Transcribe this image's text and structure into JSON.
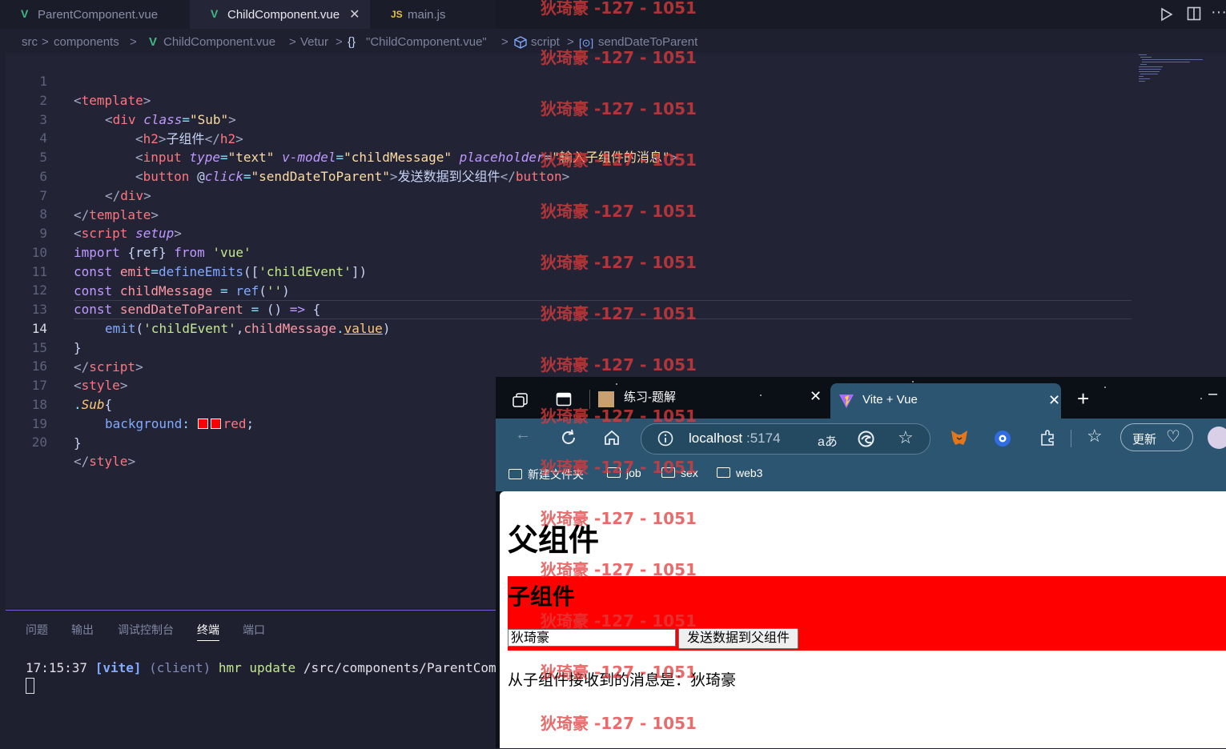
{
  "tabs": [
    {
      "icon": "V",
      "label": "ParentComponent.vue"
    },
    {
      "icon": "V",
      "label": "ChildComponent.vue",
      "close": "✕"
    },
    {
      "icon": "JS",
      "label": "main.js"
    }
  ],
  "breadcrumb": [
    "src",
    ">",
    "components",
    ">",
    "V",
    "ChildComponent.vue",
    ">",
    "Vetur",
    ">",
    "{}",
    "\"ChildComponent.vue\"",
    ">",
    "script",
    ">",
    "sendDateToParent"
  ],
  "line_numbers": [
    "1",
    "2",
    "3",
    "4",
    "5",
    "6",
    "7",
    "8",
    "9",
    "10",
    "11",
    "12",
    "13",
    "14",
    "15",
    "16",
    "17",
    "18",
    "19",
    "20"
  ],
  "code": {
    "l1": [
      "<",
      "template",
      ">"
    ],
    "l2": [
      "<",
      "div",
      "class",
      "=",
      "\"Sub\"",
      ">"
    ],
    "l3": [
      "<",
      "h2",
      ">",
      "子组件",
      "</",
      "h2",
      ">"
    ],
    "l4": [
      "<",
      "input",
      "type",
      "=",
      "\"text\"",
      "v-model",
      "=",
      "\"childMessage\"",
      "placeholder",
      "=",
      "\"输入子组件的消息\"",
      ">"
    ],
    "l5": [
      "<",
      "button",
      "@",
      "click",
      "=",
      "\"sendDateToParent\"",
      ">",
      "发送数据到父组件",
      "</",
      "button",
      ">"
    ],
    "l6": [
      "</",
      "div",
      ">"
    ],
    "l7": [
      "</",
      "template",
      ">"
    ],
    "l8": [
      "<",
      "script",
      "setup",
      ">"
    ],
    "l9": [
      "import",
      "{ref}",
      "from",
      "'vue'"
    ],
    "l10": [
      "const",
      "emit",
      "=",
      "defineEmits",
      "([",
      "'childEvent'",
      "])"
    ],
    "l11": [
      "const",
      "childMessage",
      "=",
      "ref",
      "(",
      "''",
      ")"
    ],
    "l12": [
      "const",
      "sendDateToParent",
      "=",
      "()",
      "=>",
      "{"
    ],
    "l13": [
      "emit",
      "(",
      "'childEvent'",
      ",",
      "childMessage",
      ".",
      "value",
      ")"
    ],
    "l14": [
      "}"
    ],
    "l15": [
      "</",
      "script",
      ">"
    ],
    "l16": [
      "<",
      "style",
      ">"
    ],
    "l17": [
      ".",
      "Sub",
      "{"
    ],
    "l18": [
      "background",
      ":",
      "red",
      ";"
    ],
    "l19": [
      "}"
    ],
    "l20": [
      "</",
      "style",
      ">"
    ]
  },
  "panel": {
    "tabs": [
      "问题",
      "输出",
      "调试控制台",
      "终端",
      "端口"
    ],
    "terminal": {
      "time": "17:15:37",
      "tag": "[vite]",
      "client": "(client)",
      "msg": "hmr update",
      "path": "/src/components/ParentCompone"
    }
  },
  "browser": {
    "tabs": [
      {
        "label": "练习-题解"
      },
      {
        "label": "Vite + Vue"
      }
    ],
    "url_host": "localhost",
    "url_port": ":5174",
    "update_label": "更新",
    "bookmarks": [
      "新建文件夹",
      "job",
      "sex",
      "web3"
    ],
    "page": {
      "h1": "父组件",
      "h2": "子组件",
      "input_value": "狄琦豪",
      "button_label": "发送数据到父组件",
      "message": "从子组件接收到的消息是：狄琦豪"
    }
  },
  "watermark": "狄琦豪 -127 - 1051",
  "colors": {
    "accent": "#7e5fd6",
    "sub_bg": "#ff0000",
    "vue": "#41b883",
    "js": "#e3c14a"
  }
}
